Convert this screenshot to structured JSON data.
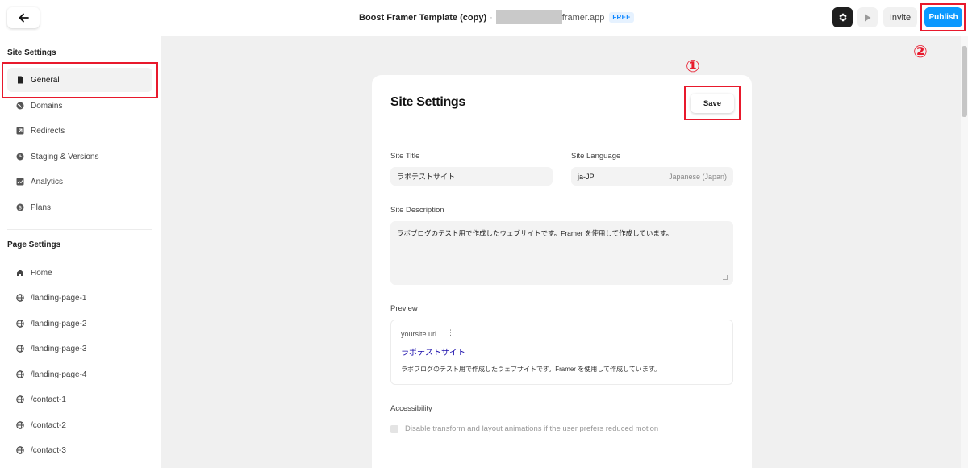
{
  "topbar": {
    "project_name": "Boost Framer Template (copy)",
    "separator": "·",
    "domain_suffix": "framer.app",
    "plan_badge": "FREE",
    "invite_label": "Invite",
    "publish_label": "Publish",
    "icons": {
      "back": "arrow-left-icon",
      "settings": "gear-icon",
      "preview": "play-icon"
    }
  },
  "annotations": {
    "step1": "①",
    "step2": "②",
    "color": "#e8192c"
  },
  "sidebar": {
    "site_heading": "Site Settings",
    "site_items": [
      {
        "label": "General",
        "icon": "document-icon",
        "active": true
      },
      {
        "label": "Domains",
        "icon": "globe-icon"
      },
      {
        "label": "Redirects",
        "icon": "redirect-icon"
      },
      {
        "label": "Staging & Versions",
        "icon": "clock-icon"
      },
      {
        "label": "Analytics",
        "icon": "chart-icon"
      },
      {
        "label": "Plans",
        "icon": "dollar-icon"
      }
    ],
    "page_heading": "Page Settings",
    "page_items": [
      {
        "label": "Home",
        "icon": "home-icon"
      },
      {
        "label": "/landing-page-1",
        "icon": "globe-icon"
      },
      {
        "label": "/landing-page-2",
        "icon": "globe-icon"
      },
      {
        "label": "/landing-page-3",
        "icon": "globe-icon"
      },
      {
        "label": "/landing-page-4",
        "icon": "globe-icon"
      },
      {
        "label": "/contact-1",
        "icon": "globe-icon"
      },
      {
        "label": "/contact-2",
        "icon": "globe-icon"
      },
      {
        "label": "/contact-3",
        "icon": "globe-icon"
      }
    ]
  },
  "main": {
    "title": "Site Settings",
    "save_label": "Save",
    "site_title_label": "Site Title",
    "site_title_value": "ラボテストサイト",
    "site_language_label": "Site Language",
    "site_language_code": "ja-JP",
    "site_language_name": "Japanese (Japan)",
    "description_label": "Site Description",
    "description_value": "ラボブログのテスト用で作成したウェブサイトです。Framer を使用して作成しています。",
    "preview_label": "Preview",
    "preview_url": "yoursite.url",
    "preview_menu": "⋮",
    "preview_title": "ラボテストサイト",
    "preview_description": "ラボブログのテスト用で作成したウェブサイトです。Framer を使用して作成しています。",
    "accessibility_label": "Accessibility",
    "reduced_motion_label": "Disable transform and layout animations if the user prefers reduced motion",
    "reduced_motion_checked": false
  },
  "colors": {
    "accent": "#0a99ff",
    "preview_link": "#1a0dab",
    "annotation": "#e8192c"
  }
}
